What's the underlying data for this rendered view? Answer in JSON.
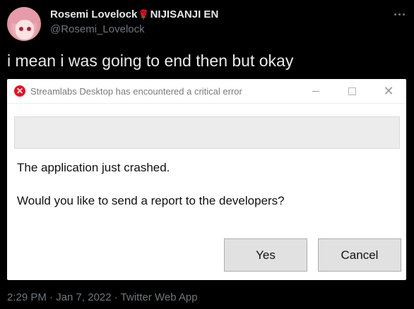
{
  "tweet": {
    "display_name": "Rosemi Lovelock",
    "name_emoji": "🌹",
    "name_suffix": "NIJISANJI EN",
    "handle": "@Rosemi_Lovelock",
    "text": "i mean i was going to end then but okay",
    "timestamp": "2:29 PM · Jan 7, 2022 · Twitter Web App"
  },
  "dialog": {
    "title": "Streamlabs Desktop has encountered a critical error",
    "message_line_1": "The application just crashed.",
    "message_line_2": "Would you like to send a report to the developers?",
    "yes_label": "Yes",
    "cancel_label": "Cancel",
    "close_glyph": "✕",
    "error_glyph": "✕"
  },
  "colors": {
    "background": "#000000",
    "primary_text": "#e7e9ea",
    "secondary_text": "#71767b",
    "error_red": "#e81123"
  },
  "icons": {
    "more": "more-horizontal-icon",
    "error": "error-x-circle-icon",
    "minimize": "minimize-icon",
    "maximize": "maximize-icon",
    "close": "close-icon"
  }
}
